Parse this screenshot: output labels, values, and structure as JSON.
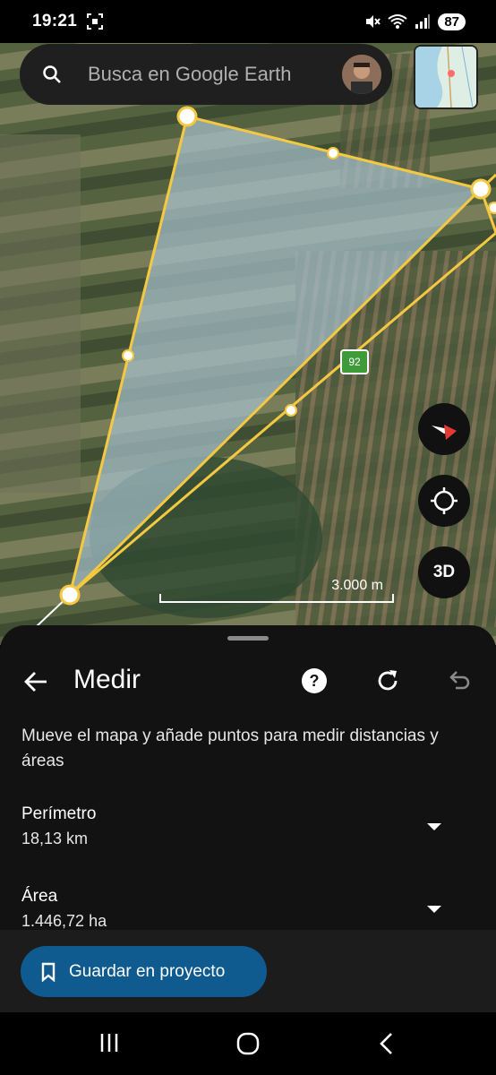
{
  "status_bar": {
    "time": "19:21",
    "battery": "87"
  },
  "search": {
    "placeholder": "Busca en Google Earth"
  },
  "map": {
    "road_badge": "92",
    "scale_label": "3.000 m",
    "button_3d": "3D",
    "colors": {
      "polygon_fill": "#9fb7c4",
      "polygon_stroke": "#f5c842",
      "badge_bg": "#3f9a3a"
    }
  },
  "sheet": {
    "title": "Medir",
    "description": "Mueve el mapa y añade puntos para medir distancias y áreas",
    "perimeter_label": "Perímetro",
    "perimeter_value": "18,13 km",
    "area_label": "Área",
    "area_value": "1.446,72 ha",
    "save_button": "Guardar en proyecto",
    "save_button_color": "#0f5a8f"
  },
  "icons": {
    "search": "search-icon",
    "back": "back-arrow-icon",
    "help": "help-icon",
    "refresh": "refresh-icon",
    "undo": "undo-icon",
    "bookmark": "bookmark-icon",
    "compass": "compass-icon",
    "locate": "my-location-icon"
  }
}
